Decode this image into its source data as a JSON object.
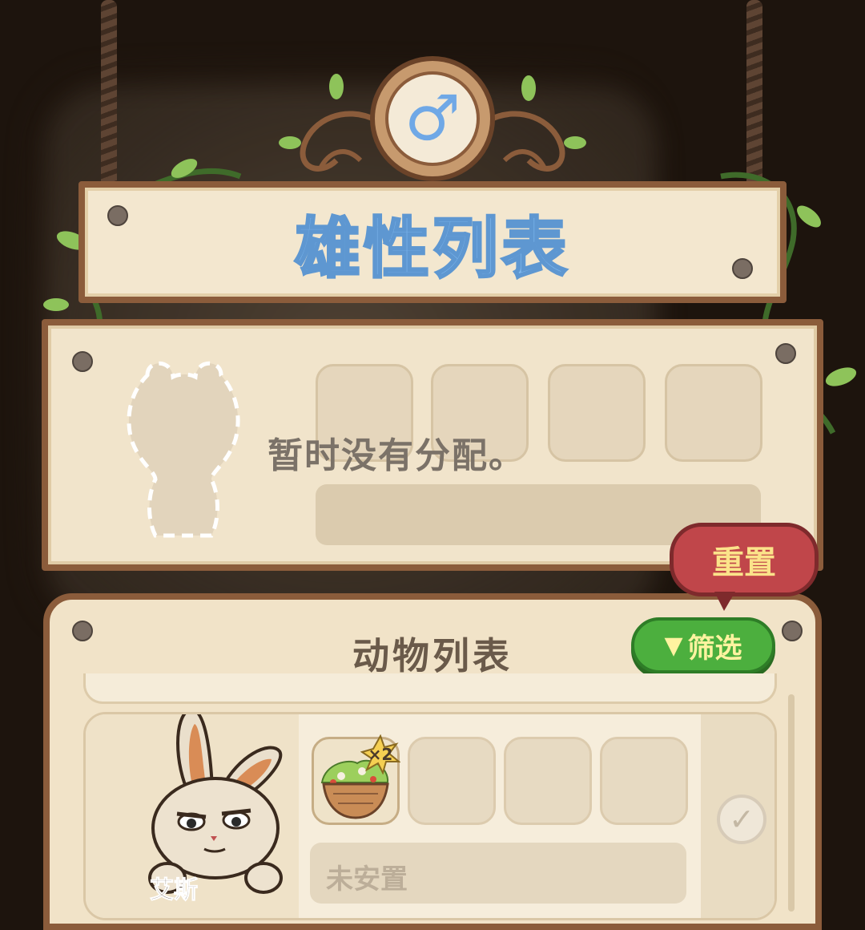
{
  "header": {
    "gender_symbol": "♂",
    "title": "雄性列表"
  },
  "assignment": {
    "empty_text": "暂时没有分配。"
  },
  "animal_list": {
    "title": "动物列表",
    "filter_label": "筛选",
    "reset_label": "重置",
    "animals": [
      {
        "name": "艾斯",
        "food_multiplier": "×2",
        "status": "未安置"
      }
    ]
  },
  "colors": {
    "title_blue": "#7fb8ee",
    "wood": "#8b5c3b",
    "parchment": "#f3e7cf",
    "filter_green": "#4caf3e",
    "reset_red": "#c0464a"
  }
}
